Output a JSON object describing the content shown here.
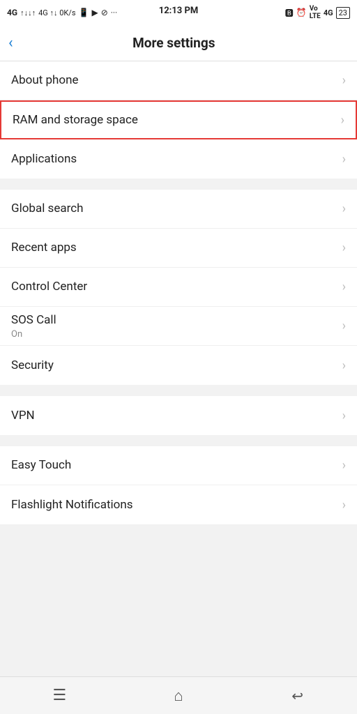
{
  "statusBar": {
    "leftText": "4G ↑↓ 0K/s",
    "time": "12:13 PM",
    "battery": "23",
    "icons": "🔵 ⏰ Vo LTE 4G"
  },
  "header": {
    "backLabel": "‹",
    "title": "More settings"
  },
  "sections": [
    {
      "id": "section1",
      "items": [
        {
          "id": "about-phone",
          "label": "About phone",
          "sublabel": "",
          "highlighted": false
        },
        {
          "id": "ram-storage",
          "label": "RAM and storage space",
          "sublabel": "",
          "highlighted": true
        },
        {
          "id": "applications",
          "label": "Applications",
          "sublabel": "",
          "highlighted": false
        }
      ]
    },
    {
      "id": "section2",
      "items": [
        {
          "id": "global-search",
          "label": "Global search",
          "sublabel": "",
          "highlighted": false
        },
        {
          "id": "recent-apps",
          "label": "Recent apps",
          "sublabel": "",
          "highlighted": false
        },
        {
          "id": "control-center",
          "label": "Control Center",
          "sublabel": "",
          "highlighted": false
        },
        {
          "id": "sos-call",
          "label": "SOS Call",
          "sublabel": "On",
          "highlighted": false
        },
        {
          "id": "security",
          "label": "Security",
          "sublabel": "",
          "highlighted": false
        }
      ]
    },
    {
      "id": "section3",
      "items": [
        {
          "id": "vpn",
          "label": "VPN",
          "sublabel": "",
          "highlighted": false
        }
      ]
    },
    {
      "id": "section4",
      "items": [
        {
          "id": "easy-touch",
          "label": "Easy Touch",
          "sublabel": "",
          "highlighted": false
        },
        {
          "id": "flashlight-notifications",
          "label": "Flashlight Notifications",
          "sublabel": "",
          "highlighted": false
        }
      ]
    }
  ],
  "bottomNav": {
    "menu": "☰",
    "home": "⌂",
    "back": "⬚"
  },
  "chevron": "›"
}
